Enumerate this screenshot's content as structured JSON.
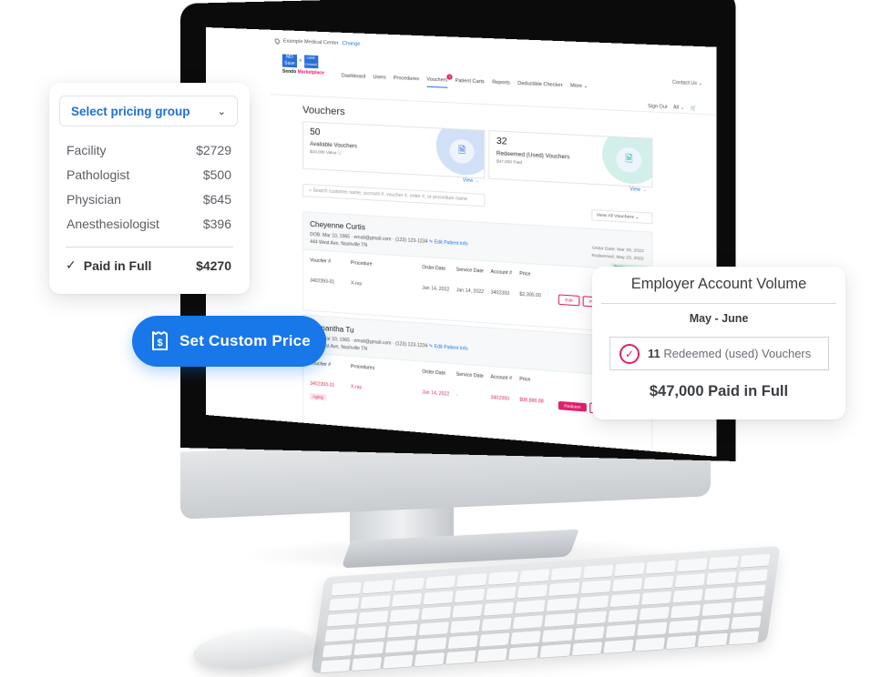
{
  "screen": {
    "location": {
      "name": "Example Medical Center",
      "change_link": "Change"
    },
    "logo": {
      "md": "MD Save",
      "plus": "+",
      "care": "CARE Connect",
      "brand_prefix": "Sendo",
      "brand_suffix": "Marketplace"
    },
    "nav": [
      {
        "label": "Dashboard"
      },
      {
        "label": "Users"
      },
      {
        "label": "Procedures"
      },
      {
        "label": "Vouchers",
        "active": true,
        "badge": "3"
      },
      {
        "label": "Patient Carts"
      },
      {
        "label": "Reports"
      },
      {
        "label": "Deductible Checker"
      },
      {
        "label": "More ⌄"
      }
    ],
    "contact": "Contact Us ⌄",
    "sign_out": "Sign Out",
    "lang": "All ⌄",
    "cart_icon": "cart-icon",
    "page_title": "Vouchers",
    "stats": [
      {
        "count": "50",
        "label": "Available Vouchers",
        "sub": "$10,000 Value ⓘ",
        "view": "View →",
        "icon": "document-search-icon",
        "color": "#2a6fd8"
      },
      {
        "count": "32",
        "label": "Redeemed (Used) Vouchers",
        "sub": "$47,000 Paid",
        "view": "View →",
        "icon": "document-check-icon",
        "color": "#2fb7a0"
      }
    ],
    "search_placeholder": "Search customer name, account #, voucher #, order #, or procedure name",
    "view_all": "View All Vouchers  ⌄",
    "patients": [
      {
        "name": "Cheyenne Curtis",
        "info": "DOB: Mar 10, 1965 · email@gmail.com · (123) 123-1234",
        "edit": "✎ Edit Patient Info",
        "address": "444 West Ave, Nashville TN",
        "order_date": "Order Date: Mar 29, 2022",
        "redeemed_date": "Redeemed: May 23, 2022",
        "columns": [
          "Voucher #",
          "Procedure",
          "Order Date",
          "Service Date",
          "Account #",
          "Price"
        ],
        "row": [
          "3402393-01",
          "X-ray",
          "Jan 14, 2022",
          "Jan 14, 2022",
          "3402393",
          "$2,300.00"
        ],
        "status_tag": "Redeemed (Used)",
        "actions": [
          "Edit",
          "Print"
        ]
      },
      {
        "name": "Samantha Tu",
        "info": "DOB: Mar 10, 1965 · email@gmail.com · (123) 123-1234",
        "edit": "✎ Edit Patient Info",
        "address": "444 West Ave, Nashville TN",
        "order_date": "Order Date",
        "columns": [
          "Voucher #",
          "Procedures",
          "Order Date",
          "Service Date",
          "Account #",
          "Price"
        ],
        "row": [
          "3402393-01",
          "X-ray",
          "Jan 14, 2022",
          "-",
          "3402393",
          "$88,888.88"
        ],
        "status_tag": "Aging",
        "actions": [
          "Redeem",
          "Print"
        ]
      }
    ]
  },
  "pricing_card": {
    "select_label": "Select pricing group",
    "items": [
      {
        "label": "Facility",
        "price": "$2729"
      },
      {
        "label": "Pathologist",
        "price": "$500"
      },
      {
        "label": "Physician",
        "price": "$645"
      },
      {
        "label": "Anesthesiologist",
        "price": "$396"
      }
    ],
    "total_label": "Paid in Full",
    "total_price": "$4270"
  },
  "custom_price_button": {
    "label": "Set Custom Price",
    "icon": "receipt-dollar-icon"
  },
  "volume_card": {
    "title": "Employer Account Volume",
    "period": "May - June",
    "redeemed_count": "11",
    "redeemed_label": "Redeemed (used) Vouchers",
    "total": "$47,000 Paid in Full"
  },
  "colors": {
    "accent_blue": "#1877e9",
    "brand_pink": "#e0206c",
    "teal": "#2fb7a0"
  }
}
